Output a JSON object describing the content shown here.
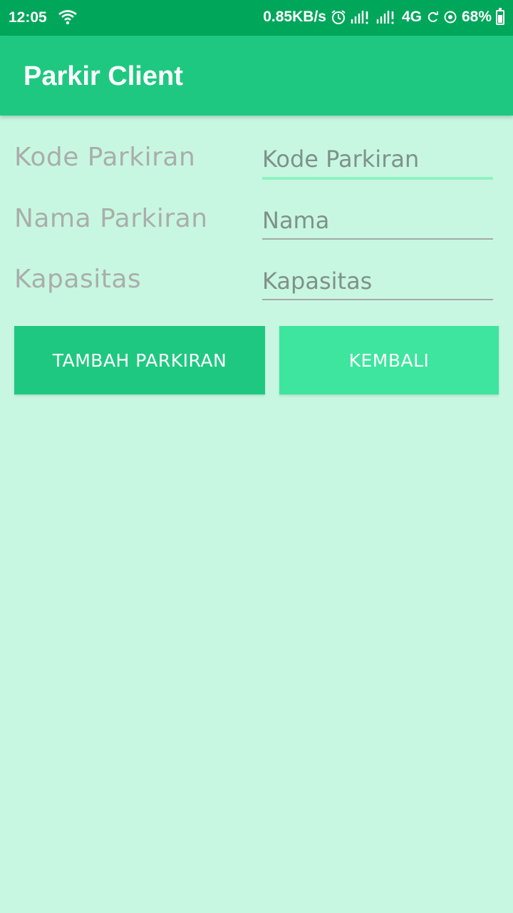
{
  "status_bar": {
    "time": "12:05",
    "speed": "0.85KB/s",
    "network": "4G",
    "battery": "68%",
    "battery_level": 0.68
  },
  "app_bar": {
    "title": "Parkir Client"
  },
  "form": {
    "kode": {
      "label": "Kode Parkiran",
      "placeholder": "Kode Parkiran",
      "value": ""
    },
    "nama": {
      "label": "Nama Parkiran",
      "placeholder": "Nama",
      "value": ""
    },
    "kapasitas": {
      "label": "Kapasitas",
      "placeholder": "Kapasitas",
      "value": ""
    }
  },
  "buttons": {
    "add_label": "TAMBAH PARKIRAN",
    "back_label": "KEMBALI"
  },
  "colors": {
    "status_bar": "#00a65a",
    "app_bar": "#1fc881",
    "background": "#c8f7e1",
    "button_add": "#1fc881",
    "button_back": "#3de59e",
    "focus_underline": "#8ff2c2"
  }
}
